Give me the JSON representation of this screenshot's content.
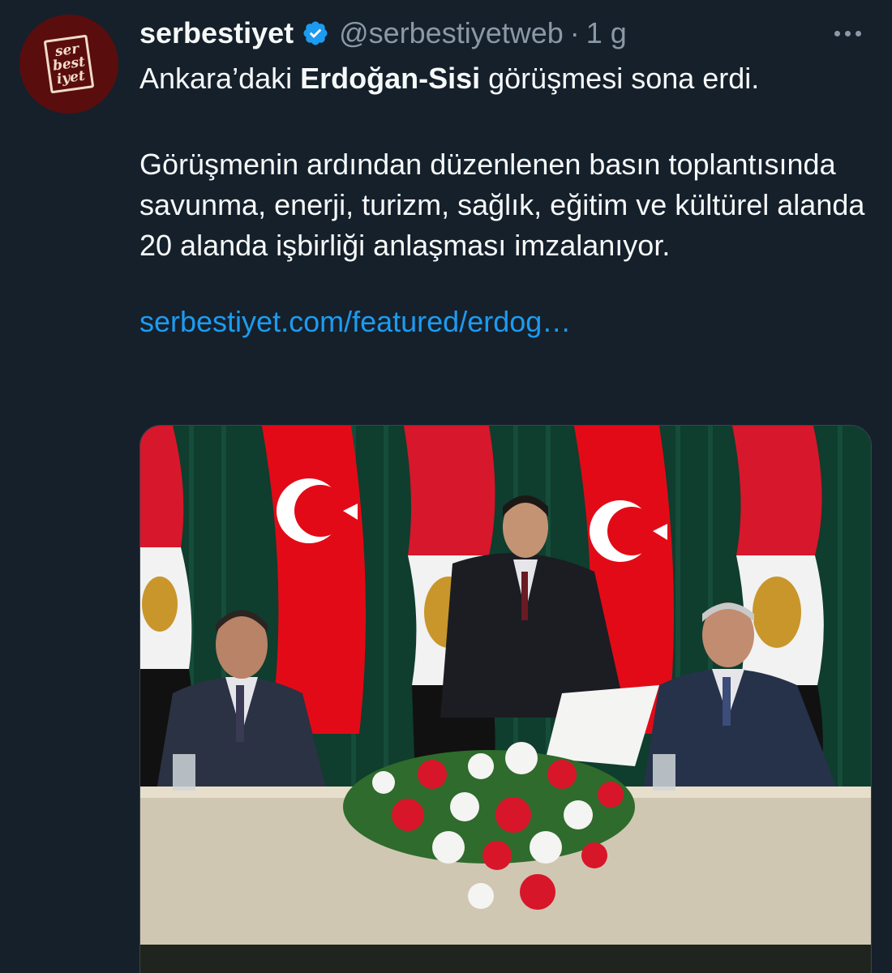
{
  "author": {
    "display_name": "serbestiyet",
    "handle": "@serbestiyetweb",
    "separator": "·",
    "time": "1 g",
    "avatar_text": [
      "ser",
      "best",
      "iyet"
    ]
  },
  "tweet": {
    "line1_pre": "Ankara’daki ",
    "line1_bold": "Erdoğan-Sisi",
    "line1_post": " görüşmesi sona erdi.",
    "paragraph2": "Görüşmenin ardından düzenlenen basın toplantısında savunma, enerji, turizm, sağlık, eğitim ve kültürel alanda 20 alanda işbirliği anlaşması imzalanıyor.",
    "link": "serbestiyet.com/featured/erdog…"
  },
  "icons": {
    "verified": "verified-badge-icon",
    "more": "more-options-icon"
  },
  "colors": {
    "background": "#15202b",
    "text": "#f7f9f9",
    "muted": "#8b98a5",
    "link": "#1d9bf0",
    "verified": "#1d9bf0"
  }
}
